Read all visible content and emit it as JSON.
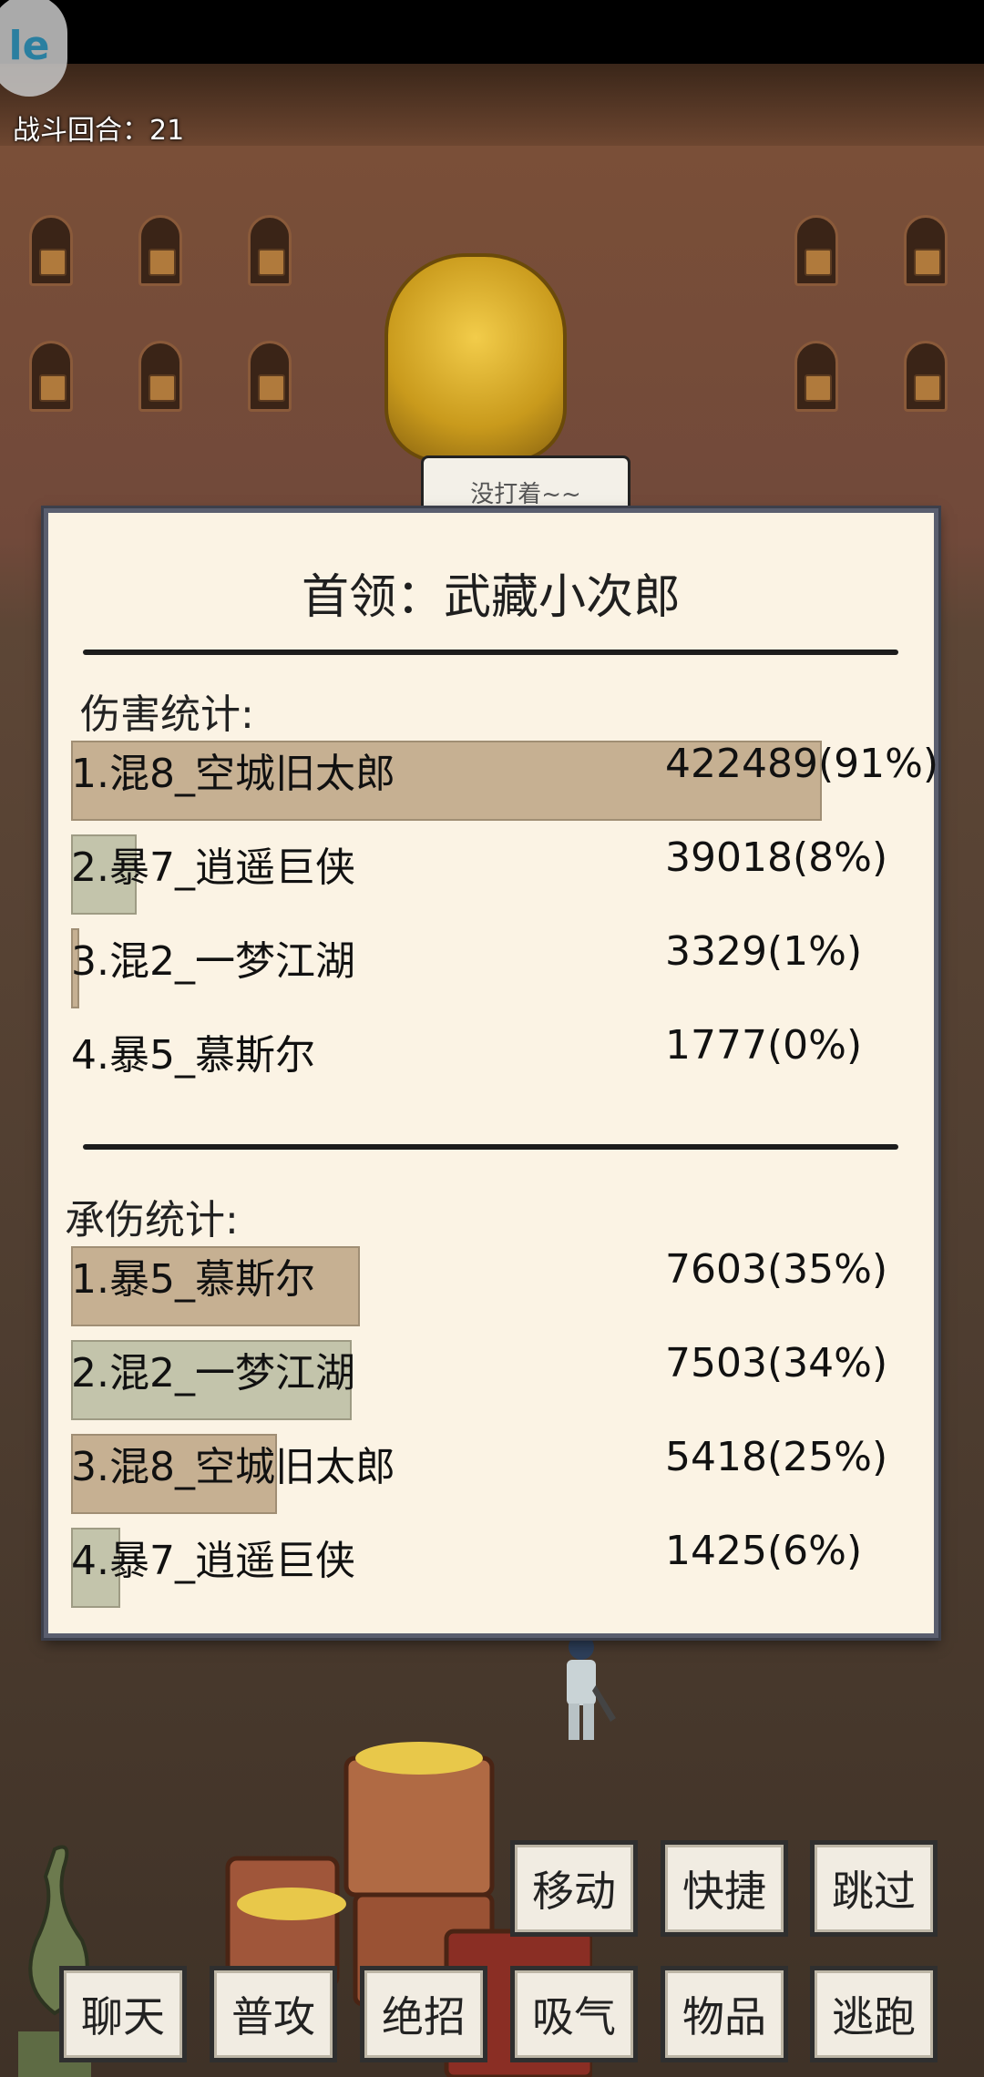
{
  "battle": {
    "turn_label": "战斗回合：21"
  },
  "app_logo_text": "le",
  "boss_speech": "没打着~~",
  "panel": {
    "title": "首领：武藏小次郎",
    "damage": {
      "label": "伤害统计:",
      "rows": [
        {
          "name": "1.混8_空城旧太郎",
          "value": "422489(91%)",
          "share": 0.91,
          "bar_color": "#c6b092"
        },
        {
          "name": "2.暴7_逍遥巨侠",
          "value": "39018(8%)",
          "share": 0.08,
          "bar_color": "#c3c4ab"
        },
        {
          "name": "3.混2_一梦江湖",
          "value": "3329(1%)",
          "share": 0.01,
          "bar_color": "#c6b092"
        },
        {
          "name": "4.暴5_慕斯尔",
          "value": "1777(0%)",
          "share": 0.0,
          "bar_color": "#c3c4ab"
        }
      ]
    },
    "tank": {
      "label": "承伤统计:",
      "rows": [
        {
          "name": "1.暴5_慕斯尔",
          "value": "7603(35%)",
          "share": 0.35,
          "bar_color": "#c6b092"
        },
        {
          "name": "2.混2_一梦江湖",
          "value": "7503(34%)",
          "share": 0.34,
          "bar_color": "#c3c4ab"
        },
        {
          "name": "3.混8_空城旧太郎",
          "value": "5418(25%)",
          "share": 0.25,
          "bar_color": "#c6b092"
        },
        {
          "name": "4.暴7_逍遥巨侠",
          "value": "1425(6%)",
          "share": 0.06,
          "bar_color": "#c3c4ab"
        }
      ]
    }
  },
  "actions": {
    "move": "移动",
    "shortcut": "快捷",
    "skip": "跳过",
    "chat": "聊天",
    "attack": "普攻",
    "ultimate": "绝招",
    "breathe": "吸气",
    "items": "物品",
    "flee": "逃跑"
  },
  "colors": {
    "panel_bg": "#fbf3e4",
    "panel_border": "#5a5e6e",
    "button_bg": "#f1ece2"
  }
}
